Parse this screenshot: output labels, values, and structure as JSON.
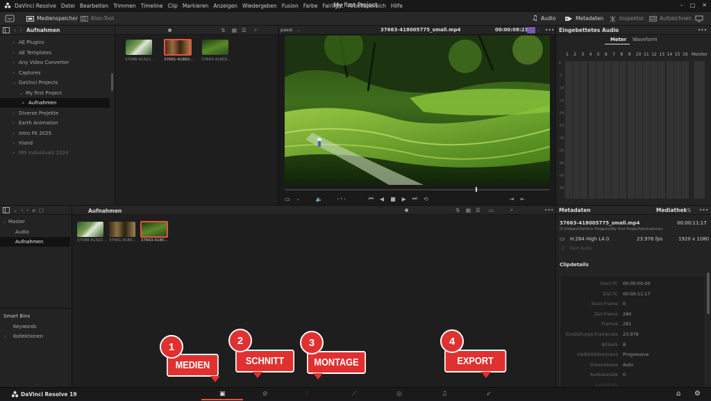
{
  "app": {
    "name": "DaVinci Resolve",
    "menu": [
      "DaVinci Resolve",
      "Datei",
      "Bearbeiten",
      "Trimmen",
      "Timeline",
      "Clip",
      "Markieren",
      "Anzeigen",
      "Wiedergeben",
      "Fusion",
      "Farbe",
      "Fairlight",
      "Arbeitsbereich",
      "Hilfe"
    ],
    "project_title": "My first Project",
    "window_buttons": [
      "–",
      "□",
      "✕"
    ]
  },
  "toolbar": {
    "media_storage": "Medienspeicher",
    "clone_tool": "Klon-Tool",
    "audio": "Audio",
    "metadata": "Metadaten",
    "inspector": "Inspektor",
    "record": "Aufzeichnen"
  },
  "media_storage": {
    "header_title": "Aufnahmen",
    "tree": [
      {
        "label": "AE Plugins",
        "arrow": "›"
      },
      {
        "label": "AE Templates",
        "arrow": "›"
      },
      {
        "label": "Any Video Converter",
        "arrow": "›"
      },
      {
        "label": "Captures",
        "arrow": "›"
      },
      {
        "label": "DaVinci Projects",
        "arrow": "⌄"
      },
      {
        "label": "My first Project",
        "arrow": "⌄"
      },
      {
        "label": "Aufnahmen",
        "arrow": "›"
      },
      {
        "label": "Diverse Projekte",
        "arrow": "›"
      },
      {
        "label": "Earth Animation",
        "arrow": "›"
      },
      {
        "label": "Intro FK 2025",
        "arrow": "›"
      },
      {
        "label": "Irland",
        "arrow": "›"
      },
      {
        "label": "MG Individuals 2024",
        "arrow": "›"
      }
    ],
    "clips": [
      "37088-41322...",
      "37661-41800...",
      "37663-41800..."
    ]
  },
  "viewer": {
    "zoom_label": "passt",
    "clip_name": "37663-418005775_small.mp4",
    "timecode": "00:00:08:23",
    "scrub_position": 0.72
  },
  "audio_panel": {
    "title": "Eingebettetes Audio",
    "tabs": [
      "Meter",
      "Waveform"
    ],
    "channels": [
      "1",
      "2",
      "3",
      "4",
      "5",
      "6",
      "7",
      "8",
      "9",
      "10",
      "11",
      "12",
      "13",
      "14",
      "15",
      "16"
    ],
    "monitor_label": "Monitor",
    "db_scale": [
      "0",
      "-5",
      "-10",
      "-15",
      "-20",
      "-25",
      "-30",
      "-35",
      "-40",
      "-45",
      "-50"
    ]
  },
  "media_pool": {
    "header_title": "Aufnahmen",
    "bins": [
      {
        "label": "Master",
        "arrow": "⌄"
      },
      {
        "label": "Audio"
      },
      {
        "label": "Aufnahmen"
      }
    ],
    "smart_bins_title": "Smart Bins",
    "smart_bins": [
      "Keywords",
      "Kollektionen"
    ],
    "clips": [
      "37088-41322...",
      "37661-4180...",
      "37663-4180..."
    ]
  },
  "metadata_panel": {
    "title": "Metadaten",
    "library": "Mediathek",
    "file_name": "37663-418005775_small.mp4",
    "duration": "00:00:11:17",
    "path": "D:\\Videos\\DaVinci Projects\\My first Project\\Aufnahmen",
    "codec": "H.264 High L4.0",
    "fps": "23.976 fps",
    "resolution": "1920 x 1080",
    "no_audio": "Kein Audio",
    "clip_details_title": "Clipdetails",
    "details": [
      {
        "k": "Start-TC",
        "v": "00:00:00:00"
      },
      {
        "k": "Ziel-TC",
        "v": "00:00:11:17"
      },
      {
        "k": "Start-Frame",
        "v": "0"
      },
      {
        "k": "Ziel-Frame",
        "v": "280"
      },
      {
        "k": "Frames",
        "v": "281"
      },
      {
        "k": "Einstellungs-Framerate",
        "v": "23.976"
      },
      {
        "k": "Bittiefe",
        "v": "8"
      },
      {
        "k": "Halbbilddominanz",
        "v": "Progressive"
      },
      {
        "k": "Datenebene",
        "v": "Auto"
      },
      {
        "k": "Audiokanäle",
        "v": "0"
      },
      {
        "k": "Audiotiefe",
        "v": ""
      }
    ]
  },
  "bottom_bar": {
    "brand": "DaVinci Resolve 19"
  },
  "callouts": [
    {
      "number": "1",
      "label": "MEDIEN"
    },
    {
      "number": "2",
      "label": "SCHNITT"
    },
    {
      "number": "3",
      "label": "MONTAGE"
    },
    {
      "number": "4",
      "label": "EXPORT"
    }
  ],
  "colors": {
    "accent_red": "#e03030",
    "active_orange": "#e8543a",
    "panel_bg": "#232323"
  }
}
